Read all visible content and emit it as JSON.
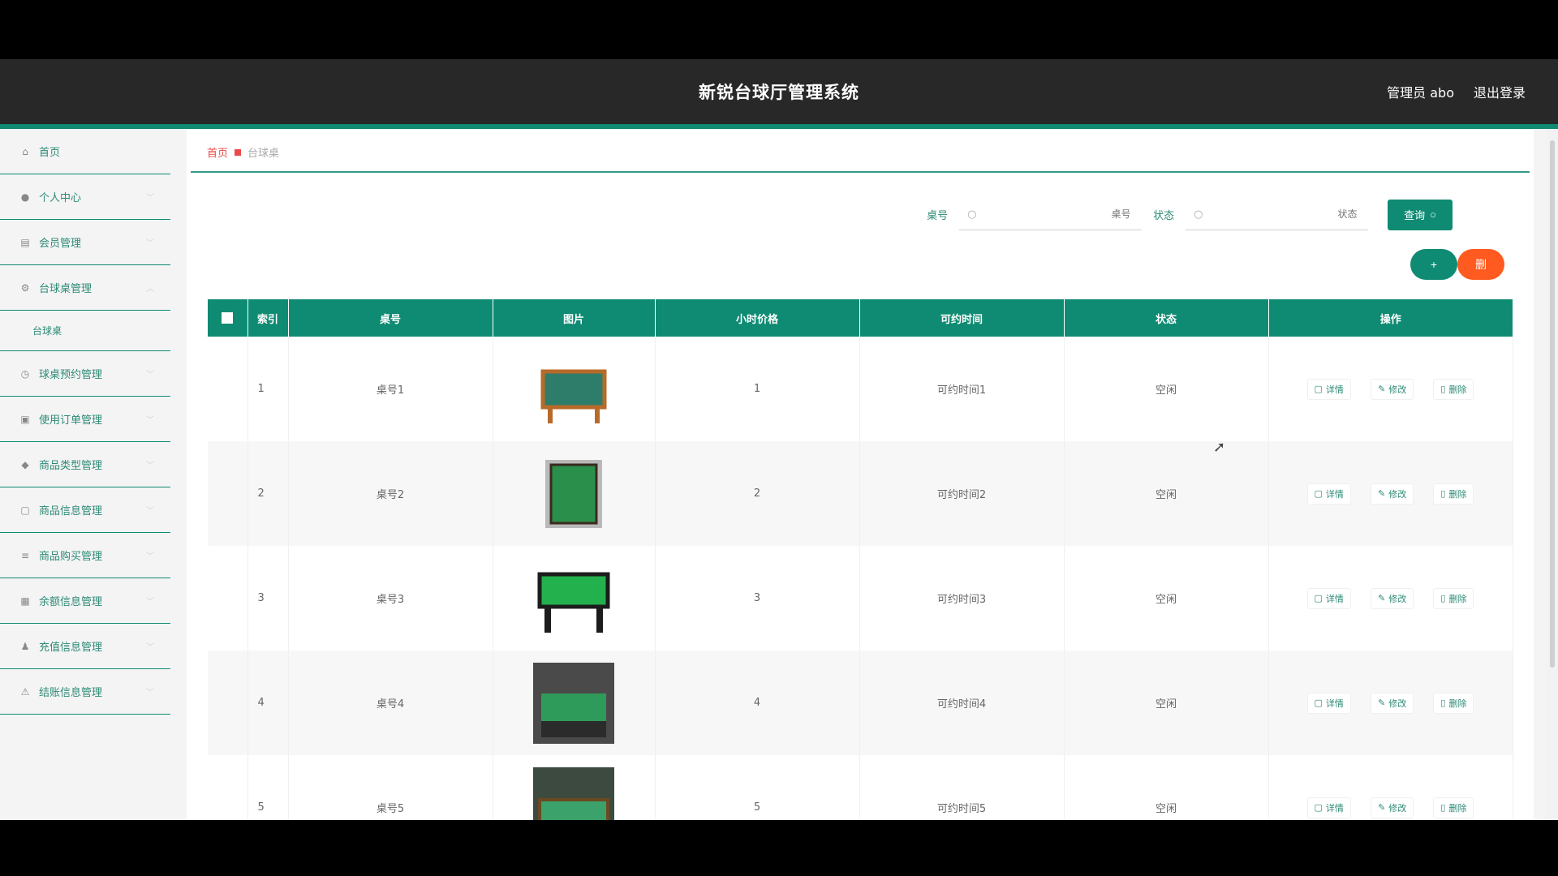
{
  "header": {
    "title": "新锐台球厅管理系统",
    "user_label": "管理员 abo",
    "logout_label": "退出登录"
  },
  "sidebar": {
    "items": [
      {
        "label": "首页",
        "icon": "home-icon",
        "chevron": false
      },
      {
        "label": "个人中心",
        "icon": "user-icon",
        "chevron": true
      },
      {
        "label": "会员管理",
        "icon": "list-icon",
        "chevron": true
      },
      {
        "label": "台球桌管理",
        "icon": "gear-icon",
        "chevron": true
      },
      {
        "label": "台球桌",
        "submenu": true
      },
      {
        "label": "球桌预约管理",
        "icon": "clock-icon",
        "chevron": true
      },
      {
        "label": "使用订单管理",
        "icon": "clipboard-icon",
        "chevron": true
      },
      {
        "label": "商品类型管理",
        "icon": "tag-icon",
        "chevron": true
      },
      {
        "label": "商品信息管理",
        "icon": "doc-icon",
        "chevron": true
      },
      {
        "label": "商品购买管理",
        "icon": "menu-icon",
        "chevron": true
      },
      {
        "label": "余额信息管理",
        "icon": "team-icon",
        "chevron": true
      },
      {
        "label": "充值信息管理",
        "icon": "award-icon",
        "chevron": true
      },
      {
        "label": "结账信息管理",
        "icon": "alert-icon",
        "chevron": true
      }
    ]
  },
  "breadcrumb": {
    "home": "首页",
    "current": "台球桌"
  },
  "search": {
    "table_no_label": "桌号",
    "table_no_placeholder": "桌号",
    "status_label": "状态",
    "status_placeholder": "状态",
    "query_label": "查询"
  },
  "actions": {
    "add_label": "+",
    "delete_label": "删"
  },
  "table": {
    "headers": [
      "索引",
      "桌号",
      "图片",
      "小时价格",
      "可约时间",
      "状态",
      "操作"
    ],
    "op_labels": {
      "detail": "详情",
      "edit": "修改",
      "delete": "删除"
    },
    "rows": [
      {
        "index": "1",
        "table_no": "桌号1",
        "price": "1",
        "time": "可约时间1",
        "status": "空闲",
        "img_color": "#2e7d6b"
      },
      {
        "index": "2",
        "table_no": "桌号2",
        "price": "2",
        "time": "可约时间2",
        "status": "空闲",
        "img_color": "#2a8f4a"
      },
      {
        "index": "3",
        "table_no": "桌号3",
        "price": "3",
        "time": "可约时间3",
        "status": "空闲",
        "img_color": "#22b14c"
      },
      {
        "index": "4",
        "table_no": "桌号4",
        "price": "4",
        "time": "可约时间4",
        "status": "空闲",
        "img_color": "#2f9b5a"
      },
      {
        "index": "5",
        "table_no": "桌号5",
        "price": "5",
        "time": "可约时间5",
        "status": "空闲",
        "img_color": "#3aa26a"
      }
    ]
  }
}
